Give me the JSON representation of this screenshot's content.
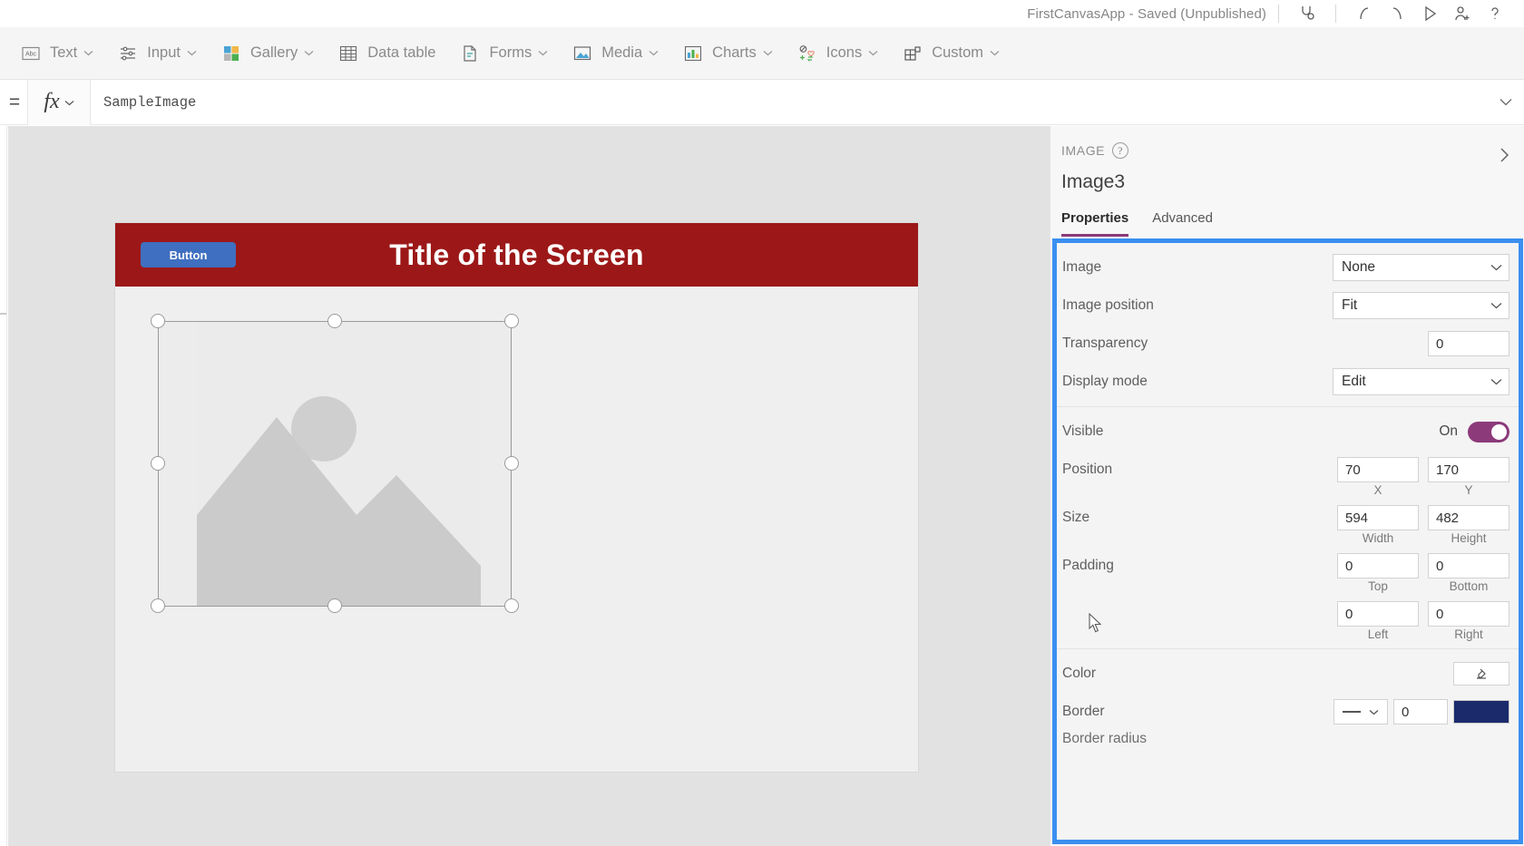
{
  "titlebar": {
    "app_title": "FirstCanvasApp - Saved (Unpublished)",
    "icons": [
      {
        "name": "health-check-icon",
        "glyph": "stethoscope"
      },
      {
        "name": "undo-icon",
        "glyph": "undo"
      },
      {
        "name": "redo-icon",
        "glyph": "redo"
      },
      {
        "name": "play-preview-icon",
        "glyph": "play"
      },
      {
        "name": "share-icon",
        "glyph": "person-add"
      },
      {
        "name": "help-icon",
        "glyph": "question"
      }
    ]
  },
  "ribbon": {
    "items": [
      {
        "label": "Text",
        "icon": "text-abc-icon",
        "caret": true
      },
      {
        "label": "Input",
        "icon": "input-sliders-icon",
        "caret": true
      },
      {
        "label": "Gallery",
        "icon": "gallery-grid-icon",
        "caret": true
      },
      {
        "label": "Data table",
        "icon": "data-table-icon",
        "caret": false
      },
      {
        "label": "Forms",
        "icon": "forms-icon",
        "caret": true
      },
      {
        "label": "Media",
        "icon": "media-image-icon",
        "caret": true
      },
      {
        "label": "Charts",
        "icon": "charts-bar-icon",
        "caret": true
      },
      {
        "label": "Icons",
        "icon": "icons-shapes-icon",
        "caret": true
      },
      {
        "label": "Custom",
        "icon": "custom-blocks-icon",
        "caret": true
      }
    ]
  },
  "formula_bar": {
    "equals": "=",
    "fx_label": "fx",
    "value": "SampleImage"
  },
  "canvas": {
    "screen_title": "Title of the Screen",
    "button_label": "Button",
    "header_color": "#9c1818",
    "button_color": "#3f6fc0",
    "screen_bg": "#efefef"
  },
  "properties_panel": {
    "kicker": "IMAGE",
    "control_name": "Image3",
    "tabs": [
      {
        "label": "Properties",
        "active": true
      },
      {
        "label": "Advanced",
        "active": false
      }
    ],
    "accent_color": "#8c3a7a",
    "highlight_color": "#3b8ff0",
    "fields": {
      "image": {
        "label": "Image",
        "value": "None"
      },
      "image_position": {
        "label": "Image position",
        "value": "Fit"
      },
      "transparency": {
        "label": "Transparency",
        "value": "0"
      },
      "display_mode": {
        "label": "Display mode",
        "value": "Edit"
      },
      "visible": {
        "label": "Visible",
        "state_label": "On",
        "on": true
      },
      "position": {
        "label": "Position",
        "x": {
          "value": "70",
          "sub": "X"
        },
        "y": {
          "value": "170",
          "sub": "Y"
        }
      },
      "size": {
        "label": "Size",
        "width": {
          "value": "594",
          "sub": "Width"
        },
        "height": {
          "value": "482",
          "sub": "Height"
        }
      },
      "padding": {
        "label": "Padding",
        "top": {
          "value": "0",
          "sub": "Top"
        },
        "bottom": {
          "value": "0",
          "sub": "Bottom"
        },
        "left": {
          "value": "0",
          "sub": "Left"
        },
        "right": {
          "value": "0",
          "sub": "Right"
        }
      },
      "color": {
        "label": "Color"
      },
      "border": {
        "label": "Border",
        "style": "—",
        "width": "0",
        "color_swatch": "#1a2a6b"
      },
      "border_radius": {
        "label": "Border radius"
      }
    }
  }
}
